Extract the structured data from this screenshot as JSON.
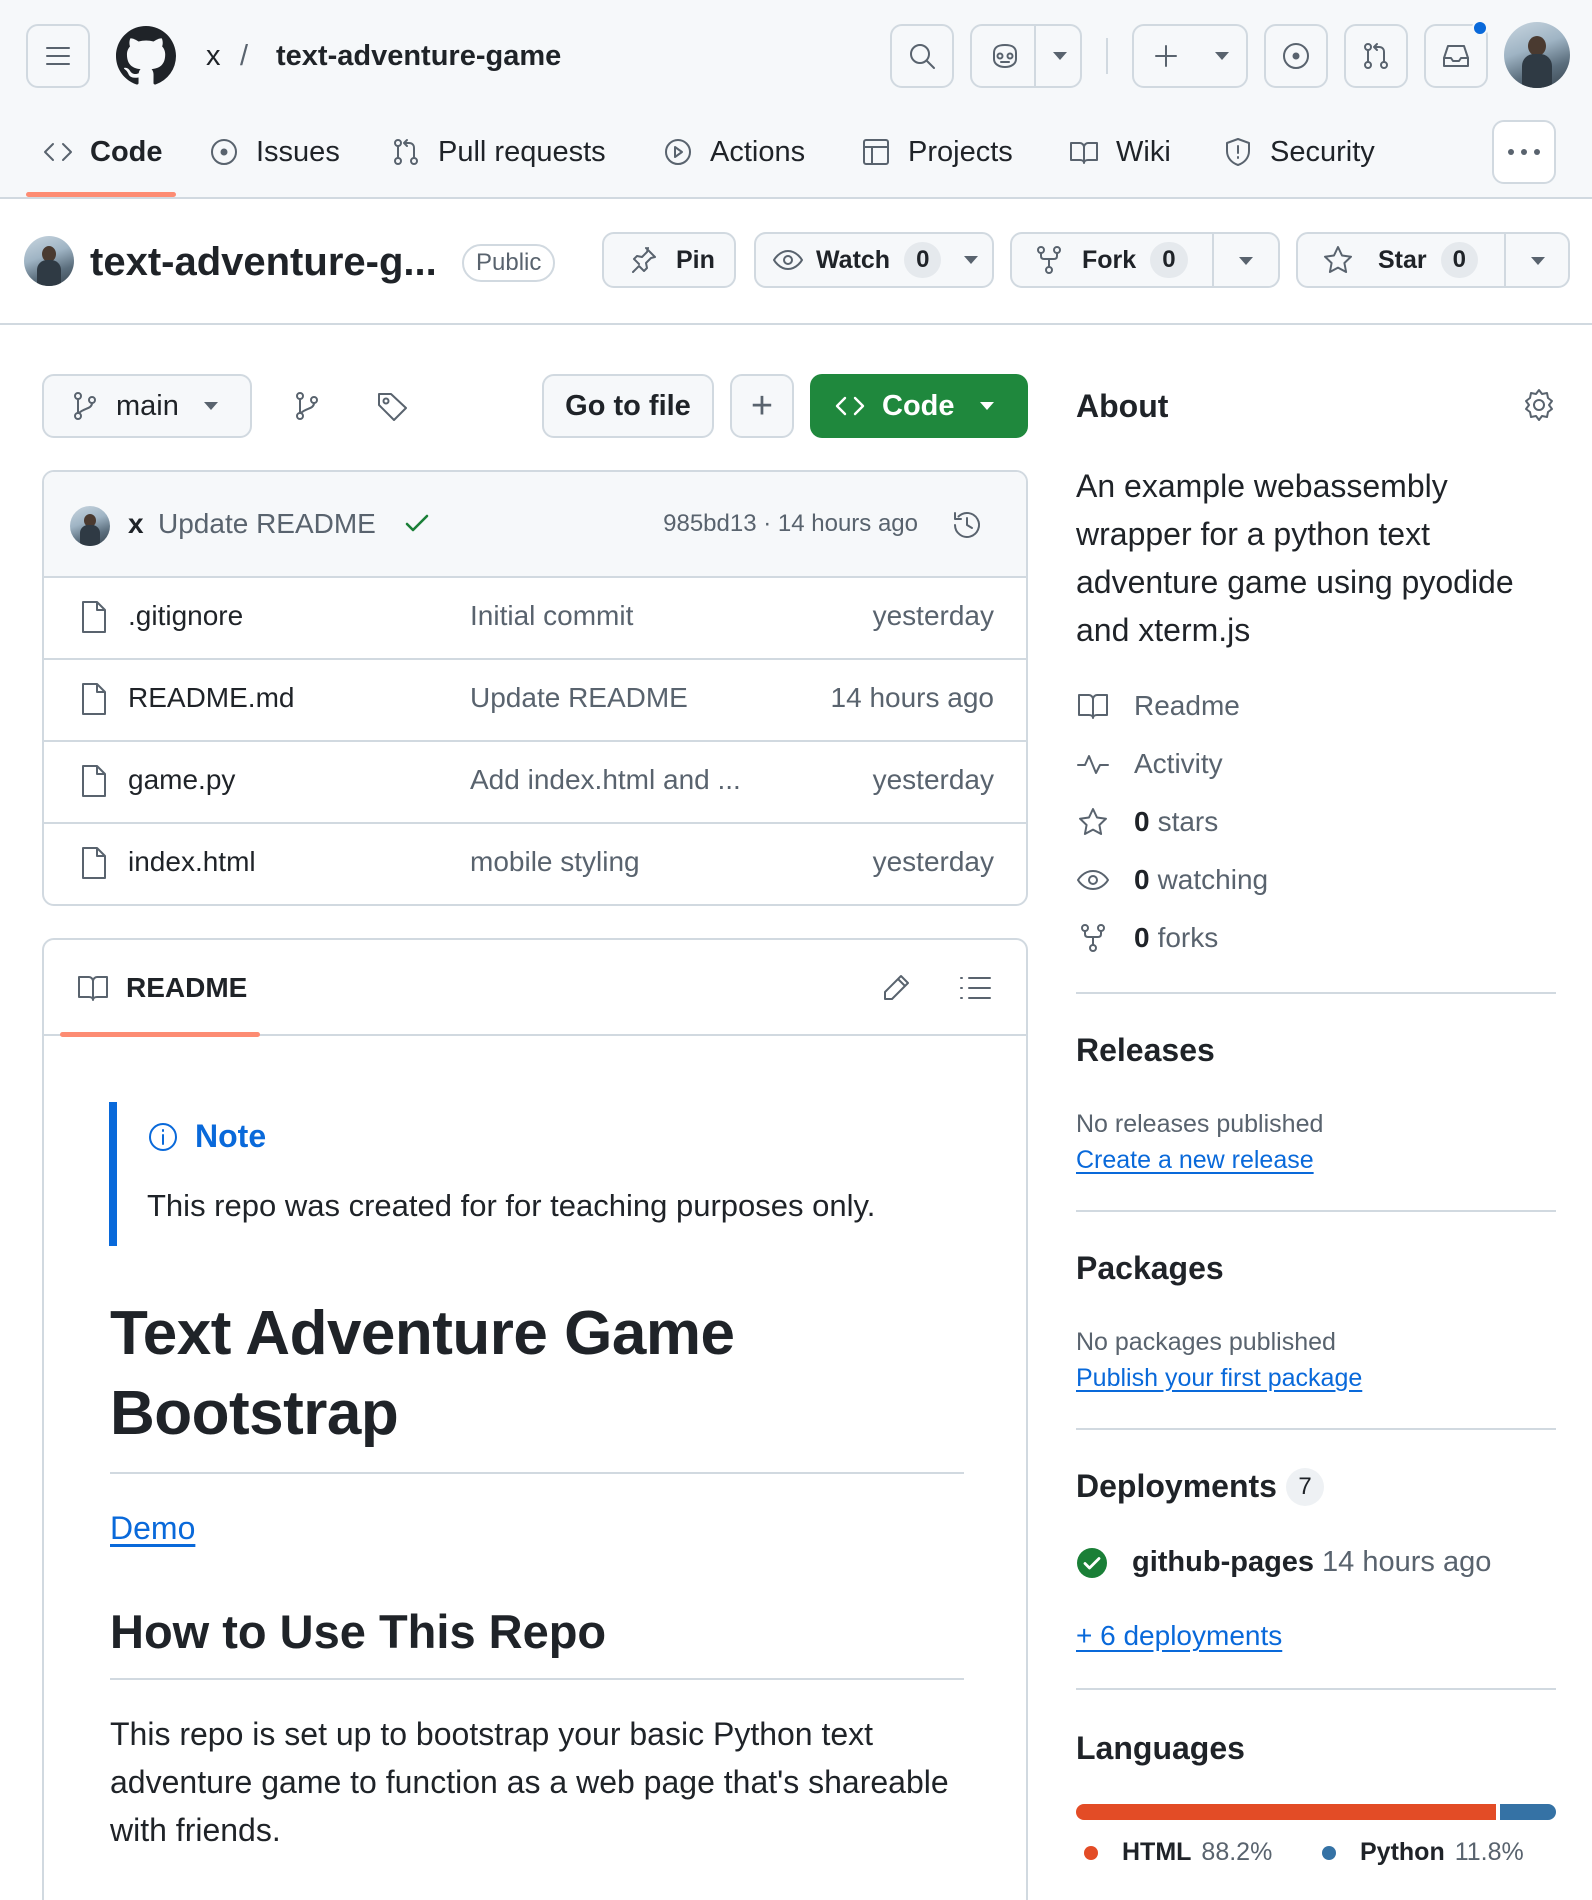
{
  "header": {
    "owner": "x",
    "separator": "/",
    "repo": "text-adventure-game",
    "tabs": [
      {
        "label": "Code"
      },
      {
        "label": "Issues"
      },
      {
        "label": "Pull requests"
      },
      {
        "label": "Actions"
      },
      {
        "label": "Projects"
      },
      {
        "label": "Wiki"
      },
      {
        "label": "Security"
      }
    ],
    "more_label": "···"
  },
  "repo_bar": {
    "name": "text-adventure-g...",
    "visibility": "Public",
    "pin_label": "Pin",
    "watch_label": "Watch",
    "watch_count": "0",
    "fork_label": "Fork",
    "fork_count": "0",
    "star_label": "Star",
    "star_count": "0"
  },
  "toolbar": {
    "branch": "main",
    "goto_file": "Go to file",
    "add": "+",
    "code": "Code"
  },
  "latest_commit": {
    "author": "x",
    "message": "Update README",
    "meta": "985bd13 · 14 hours ago"
  },
  "files": [
    {
      "name": ".gitignore",
      "message": "Initial commit",
      "time": "yesterday"
    },
    {
      "name": "README.md",
      "message": "Update README",
      "time": "14 hours ago"
    },
    {
      "name": "game.py",
      "message": "Add index.html and ...",
      "time": "yesterday"
    },
    {
      "name": "index.html",
      "message": "mobile styling",
      "time": "yesterday"
    }
  ],
  "readme": {
    "tab_label": "README",
    "note_title": "Note",
    "note_text": "This repo was created for for teaching purposes only.",
    "h1_line1": "Text Adventure Game",
    "h1_line2": "Bootstrap",
    "demo_link": "Demo",
    "h2": "How to Use This Repo",
    "paragraph": "This repo is set up to bootstrap your basic Python text adventure game to function as a web page that's shareable with friends."
  },
  "about": {
    "title": "About",
    "description": "An example webassembly wrapper for a python text adventure game using pyodide and xterm.js",
    "readme": "Readme",
    "activity": "Activity",
    "stars_count": "0",
    "stars_label": "stars",
    "watching_count": "0",
    "watching_label": "watching",
    "forks_count": "0",
    "forks_label": "forks"
  },
  "releases": {
    "title": "Releases",
    "empty": "No releases published",
    "link": "Create a new release"
  },
  "packages": {
    "title": "Packages",
    "empty": "No packages published",
    "link": "Publish your first package"
  },
  "deployments": {
    "title": "Deployments",
    "count": "7",
    "env": "github-pages",
    "time": "14 hours ago",
    "more": "+ 6 deployments"
  },
  "languages": {
    "title": "Languages",
    "items": [
      {
        "name": "HTML",
        "percent": "88.2%",
        "value": 88.2,
        "color": "#e34c26"
      },
      {
        "name": "Python",
        "percent": "11.8%",
        "value": 11.8,
        "color": "#3572a5"
      }
    ]
  },
  "colors": {
    "accent_green": "#1f883d",
    "link_blue": "#0969da",
    "tab_underline": "#fd8c73",
    "notification_dot": "#0969da"
  }
}
